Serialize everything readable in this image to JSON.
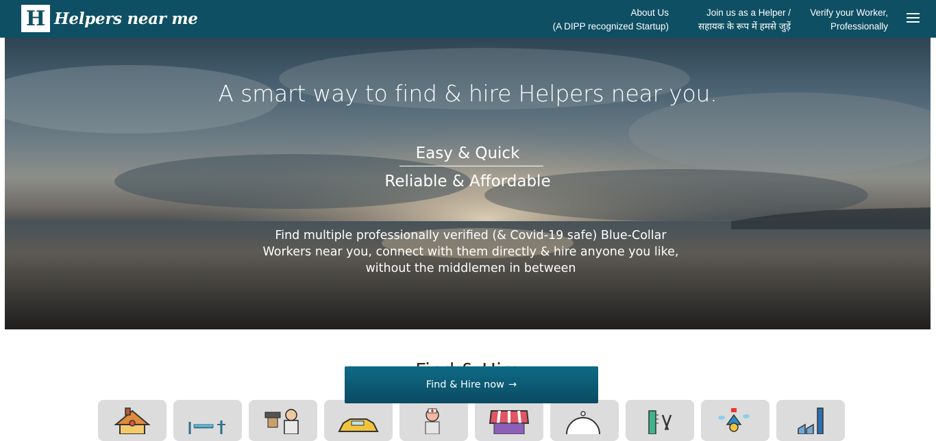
{
  "header": {
    "logo_letter": "H",
    "logo_text": "Helpers near me",
    "nav": [
      {
        "line1": "About Us",
        "line2": "(A DIPP recognized Startup)"
      },
      {
        "line1": "Join us as a Helper /",
        "line2": "सहायक के रूप में हमसे जुड़ें"
      },
      {
        "line1": "Verify your Worker,",
        "line2": "Professionally"
      }
    ],
    "menu_icon": "hamburger-menu-icon"
  },
  "hero": {
    "title": "A smart way to find & hire Helpers near you.",
    "tagline1": "Easy & Quick",
    "tagline2": "Reliable & Affordable",
    "description": "Find multiple professionally verified (& Covid-19 safe) Blue-Collar Workers near you, connect with them directly & hire anyone you like, without the middlemen in between"
  },
  "section": {
    "heading": "Find & Hire"
  },
  "cta": {
    "label": "Find & Hire now",
    "arrow": "→"
  },
  "categories": [
    {
      "icon": "house-icon"
    },
    {
      "icon": "furniture-icon"
    },
    {
      "icon": "chef-icon"
    },
    {
      "icon": "car-icon"
    },
    {
      "icon": "nurse-icon"
    },
    {
      "icon": "shop-awning-icon"
    },
    {
      "icon": "food-cloche-icon"
    },
    {
      "icon": "grooming-tools-icon"
    },
    {
      "icon": "event-decor-icon"
    },
    {
      "icon": "factory-icon"
    }
  ]
}
